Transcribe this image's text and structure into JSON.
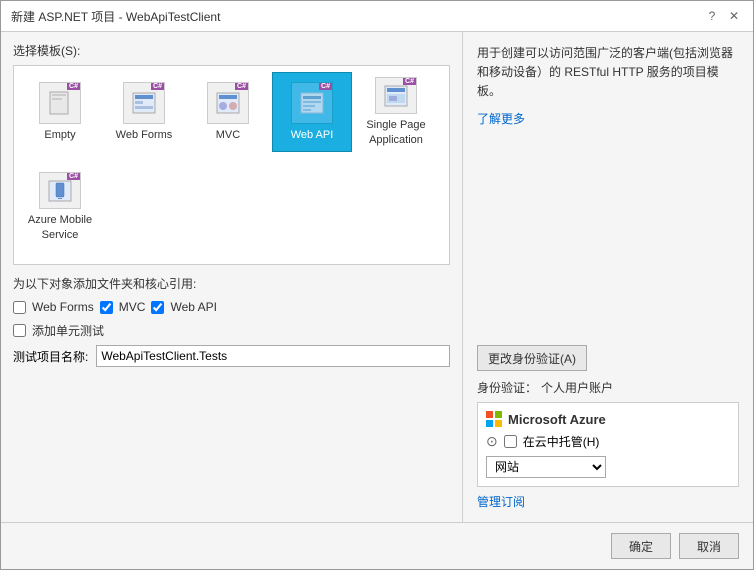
{
  "titleBar": {
    "title": "新建 ASP.NET 项目 - WebApiTestClient",
    "helpBtn": "?",
    "closeBtn": "✕"
  },
  "left": {
    "sectionLabel": "选择模板(S):",
    "templates": [
      {
        "id": "empty",
        "label": "Empty",
        "selected": false
      },
      {
        "id": "webforms",
        "label": "Web Forms",
        "selected": false
      },
      {
        "id": "mvc",
        "label": "MVC",
        "selected": false
      },
      {
        "id": "webapi",
        "label": "Web API",
        "selected": true
      },
      {
        "id": "spa",
        "label": "Single Page\nApplication",
        "selected": false
      },
      {
        "id": "azuremobile",
        "label": "Azure Mobile\nService",
        "selected": false
      }
    ],
    "addFoldersLabel": "为以下对象添加文件夹和核心引用:",
    "checkboxes": [
      {
        "id": "webforms-cb",
        "label": "Web Forms",
        "checked": false
      },
      {
        "id": "mvc-cb",
        "label": "MVC",
        "checked": true
      },
      {
        "id": "webapi-cb",
        "label": "Web API",
        "checked": true
      }
    ],
    "addTestLabel": "添加单元测试",
    "testNameLabel": "测试项目名称:",
    "testNameValue": "WebApiTestClient.Tests"
  },
  "right": {
    "description": "用于创建可以访问范围广泛的客户端(包括浏览器和移动设备）的 RESTful HTTP 服务的项目模板。",
    "learnMore": "了解更多",
    "changeAuthBtn": "更改身份验证(A)",
    "authLabel": "身份验证：",
    "authValue": "个人用户账户",
    "azureHeader": "Microsoft Azure",
    "cloudLabel": "在云中托管(H)",
    "dropdownValue": "网站",
    "manageLink": "管理订阅"
  },
  "footer": {
    "confirmBtn": "确定",
    "cancelBtn": "取消"
  }
}
